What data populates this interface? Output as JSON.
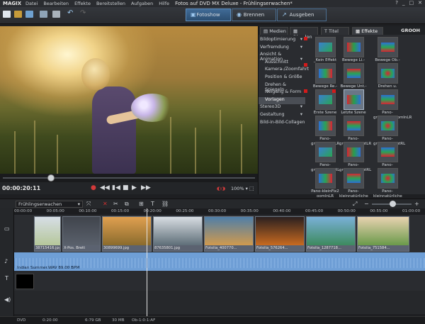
{
  "app": {
    "brand": "MAGIX",
    "title": "Fotos auf DVD MX Deluxe - Frühlingserwachen*",
    "menus": [
      "Datei",
      "Bearbeiten",
      "Effekte",
      "Bereitstellen",
      "Aufgaben",
      "Hilfe"
    ],
    "window_controls": [
      "?",
      "_",
      "□",
      "✕"
    ]
  },
  "modes": [
    {
      "label": "Fotoshow",
      "active": true,
      "icon": "slideshow-icon"
    },
    {
      "label": "Brennen",
      "active": false,
      "icon": "burn-disc-icon"
    },
    {
      "label": "Ausgeben",
      "active": false,
      "icon": "export-icon"
    }
  ],
  "preview": {
    "timecode": "00:00:20:11",
    "zoom": "100% ▾",
    "progress_fraction": 0.19,
    "transport": [
      "record-icon",
      "rewind-icon",
      "prev-marker-icon",
      "stop-icon",
      "play-icon",
      "fast-forward-icon"
    ]
  },
  "effects_panel": {
    "tabs": [
      "Medien",
      "Blenden",
      "Titel",
      "Effekte"
    ],
    "active_tab": "Effekte",
    "brand": "GROOH",
    "categories": [
      {
        "label": "Bildoptimierung",
        "arrow": "▾",
        "sub": false
      },
      {
        "label": "Verfremdung",
        "arrow": "▾",
        "sub": false
      },
      {
        "label": "Ansicht & Animation",
        "arrow": "▾",
        "sub": false
      },
      {
        "label": "Ausschnitt",
        "sub": true
      },
      {
        "label": "Kamera-/Zoomfahrt",
        "sub": true
      },
      {
        "label": "Position & Größe",
        "sub": true
      },
      {
        "label": "Drehen & Spiegeln",
        "sub": true
      },
      {
        "label": "Neigung & Form",
        "sub": true
      },
      {
        "label": "Vorlagen",
        "sub": true,
        "selected": true
      },
      {
        "label": "Stereo3D",
        "arrow": "▾",
        "sub": false
      },
      {
        "label": "Gestaltung",
        "arrow": "▾",
        "sub": false
      },
      {
        "label": "Bild-in-Bild-Collagen",
        "sub": false
      }
    ],
    "presets": [
      {
        "label": "_Kein Effekt",
        "red_marker": true
      },
      {
        "label": "Bewege Li.-Re.",
        "red_marker": false
      },
      {
        "label": "Bewege Ob.-Unt.",
        "red_marker": false
      },
      {
        "label": "Bewege Re.-Li.",
        "red_marker": true
      },
      {
        "label": "Bewege Unt.-Ob.",
        "red_marker": false
      },
      {
        "label": "Drehen u. Zoomen",
        "red_marker": false
      },
      {
        "label": "Erste Szene",
        "red_marker": true
      },
      {
        "label": "Letzte Szene",
        "red_marker": true,
        "selected": true
      },
      {
        "label": "Pano-großNachZoomInLR",
        "red_marker": false
      },
      {
        "label": "Pano-großZoominLR",
        "red_marker": false
      },
      {
        "label": "Pano-großZoomOutLR",
        "red_marker": false
      },
      {
        "label": "Pano-großZoomOutRL",
        "red_marker": false
      },
      {
        "label": "Pano-großZoomInRL",
        "red_marker": false
      },
      {
        "label": "Pano-großZoomOutRL",
        "red_marker": false
      },
      {
        "label": "Pano-großZoom",
        "red_marker": false
      },
      {
        "label": "Pano-kleinFix2 oomInLR",
        "red_marker": false
      },
      {
        "label": "Pano-kleinnatürliche Kamera",
        "red_marker": false
      },
      {
        "label": "Pano-kleinnatürliche Kamera2",
        "red_marker": false
      }
    ]
  },
  "timeline": {
    "project": "Frühlingserwachen",
    "ruler": [
      "00:00:00",
      "00:05:00",
      "00:10:00",
      "00:15:00",
      "00:20:00",
      "00:25:00",
      "00:30:00",
      "00:35:00",
      "00:40:00",
      "00:45:00",
      "00:50:00",
      "00:55:00",
      "01:00:00"
    ],
    "clips": [
      {
        "name": "38715416.jpg"
      },
      {
        "name": "X-Pos. Brett"
      },
      {
        "name": "30899699.jpg"
      },
      {
        "name": "87635801.jpg"
      },
      {
        "name": "Fotolia_400770..."
      },
      {
        "name": "Fotolia_576264..."
      },
      {
        "name": "Fotolia_1287718..."
      },
      {
        "name": "Fotolia_751584..."
      }
    ],
    "audio": "Indian Summer.WAV  89.00 BPM"
  },
  "status": [
    "DVD",
    "0:20:00",
    "6:79 GB",
    "30 MB",
    "Ob-1:0:1:AF"
  ],
  "colors": {
    "accent": "#4a6d8f",
    "audio_track": "#6f9fd6",
    "red_marker": "#d21b1b"
  }
}
